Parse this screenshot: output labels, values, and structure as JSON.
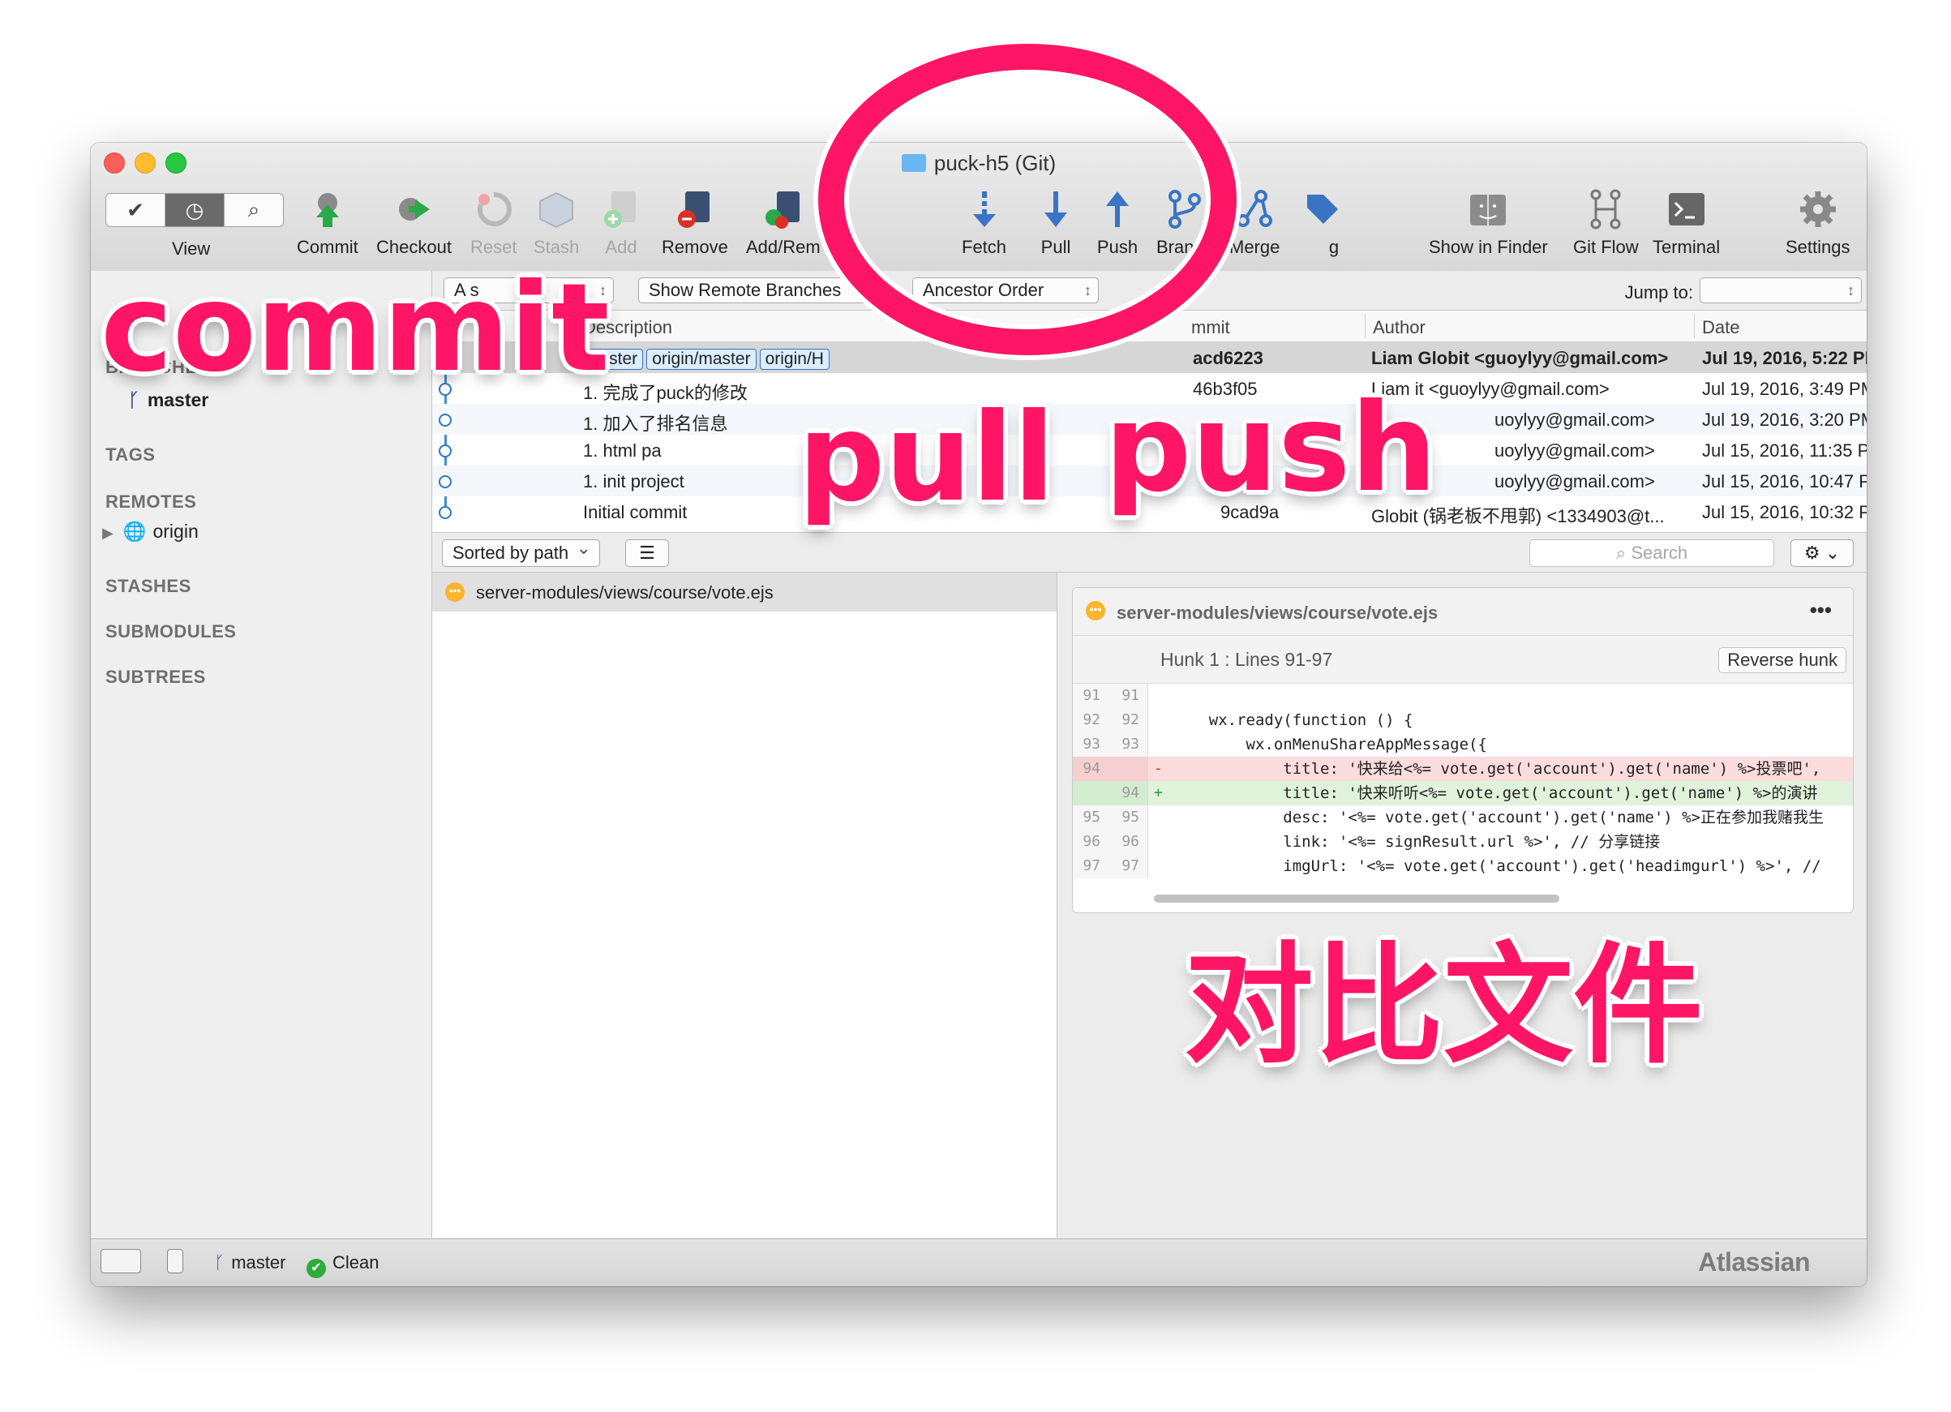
{
  "window": {
    "title": "puck-h5 (Git)"
  },
  "toolbar": {
    "view_label": "View",
    "items": [
      {
        "label": "Commit",
        "icon": "commit-icon",
        "color": "#2aa84a"
      },
      {
        "label": "Checkout",
        "icon": "checkout-icon",
        "color": "#2aa84a"
      },
      {
        "label": "Reset",
        "icon": "reset-icon",
        "dim": true
      },
      {
        "label": "Stash",
        "icon": "stash-icon",
        "dim": true
      },
      {
        "label": "Add",
        "icon": "add-icon",
        "dim": true
      },
      {
        "label": "Remove",
        "icon": "remove-icon",
        "color": "#d93025"
      },
      {
        "label": "Add/Rem",
        "icon": "add-remove-icon"
      },
      {
        "label": "Fetch",
        "icon": "fetch-icon",
        "color": "#3a74c4"
      },
      {
        "label": "Pull",
        "icon": "pull-icon",
        "color": "#3a74c4"
      },
      {
        "label": "Push",
        "icon": "push-icon",
        "color": "#3a74c4"
      },
      {
        "label": "Branch",
        "icon": "branch-icon",
        "color": "#3a74c4"
      },
      {
        "label": "Merge",
        "icon": "merge-icon",
        "color": "#3a74c4"
      },
      {
        "label": "g",
        "icon": "tag-icon",
        "color": "#3a74c4"
      },
      {
        "label": "Show in Finder",
        "icon": "finder-icon"
      },
      {
        "label": "Git Flow",
        "icon": "git-flow-icon"
      },
      {
        "label": "Terminal",
        "icon": "terminal-icon"
      },
      {
        "label": "Settings",
        "icon": "gear-icon"
      }
    ]
  },
  "sidebar": {
    "branches_header": "BRANCHES",
    "branch": "master",
    "tags_header": "TAGS",
    "remotes_header": "REMOTES",
    "remote": "origin",
    "stashes_header": "STASHES",
    "submodules_header": "SUBMODULES",
    "subtrees_header": "SUBTREES"
  },
  "filters": {
    "branches_select": "A                    s",
    "remote_select": "Show Remote Branches",
    "order_select": "Ancestor Order",
    "jump_label": "Jump to:"
  },
  "history": {
    "columns": [
      "Description",
      "mmit",
      "Author",
      "Date"
    ],
    "tags": [
      "master",
      "origin/master",
      "origin/H"
    ],
    "rows": [
      {
        "desc": "",
        "commit": "acd6223",
        "author": "Liam Globit <guoylyy@gmail.com>",
        "date": "Jul 19, 2016, 5:22 PM"
      },
      {
        "desc": "1. 完成了puck的修改",
        "commit": "46b3f05",
        "author": "Liam        it <guoylyy@gmail.com>",
        "date": "Jul 19, 2016, 3:49 PM"
      },
      {
        "desc": "1. 加入了排名信息",
        "commit": "",
        "author": "uoylyy@gmail.com>",
        "date": "Jul 19, 2016, 3:20 PM"
      },
      {
        "desc": "1. html pa",
        "commit": "",
        "author": "uoylyy@gmail.com>",
        "date": "Jul 15, 2016, 11:35 PM"
      },
      {
        "desc": "1. init project",
        "commit": "",
        "author": "uoylyy@gmail.com>",
        "date": "Jul 15, 2016, 10:47 PM"
      },
      {
        "desc": "Initial commit",
        "commit": "9cad9a",
        "author": "Globit (锅老板不甩郭) <1334903@t...",
        "date": "Jul 15, 2016, 10:32 PM"
      }
    ]
  },
  "files": {
    "sort_label": "Sorted by path",
    "search_placeholder": "Search",
    "file": "server-modules/views/course/vote.ejs"
  },
  "diff": {
    "file": "server-modules/views/course/vote.ejs",
    "more": "•••",
    "hunk_title": "Hunk 1 : Lines 91-97",
    "reverse_label": "Reverse hunk",
    "lines": [
      {
        "old": "91",
        "new": "91",
        "sign": "",
        "type": "ctx",
        "text": ""
      },
      {
        "old": "92",
        "new": "92",
        "sign": "",
        "type": "ctx",
        "text": "    wx.ready(function () {"
      },
      {
        "old": "93",
        "new": "93",
        "sign": "",
        "type": "ctx",
        "text": "        wx.onMenuShareAppMessage({"
      },
      {
        "old": "94",
        "new": "",
        "sign": "-",
        "type": "del",
        "text": "            title: '快来给<%= vote.get('account').get('name') %>投票吧',"
      },
      {
        "old": "",
        "new": "94",
        "sign": "+",
        "type": "add",
        "text": "            title: '快来听听<%= vote.get('account').get('name') %>的演讲"
      },
      {
        "old": "95",
        "new": "95",
        "sign": "",
        "type": "ctx",
        "text": "            desc: '<%= vote.get('account').get('name') %>正在参加我赌我生"
      },
      {
        "old": "96",
        "new": "96",
        "sign": "",
        "type": "ctx",
        "text": "            link: '<%= signResult.url %>', // 分享链接"
      },
      {
        "old": "97",
        "new": "97",
        "sign": "",
        "type": "ctx",
        "text": "            imgUrl: '<%= vote.get('account').get('headimgurl') %>', //"
      }
    ]
  },
  "status": {
    "branch": "master",
    "state": "Clean",
    "brand": "Atlassian"
  },
  "annotations": {
    "commit": "commit",
    "pull": "pull",
    "push": "push",
    "compare": "对比文件",
    "color": "#ff1565"
  }
}
